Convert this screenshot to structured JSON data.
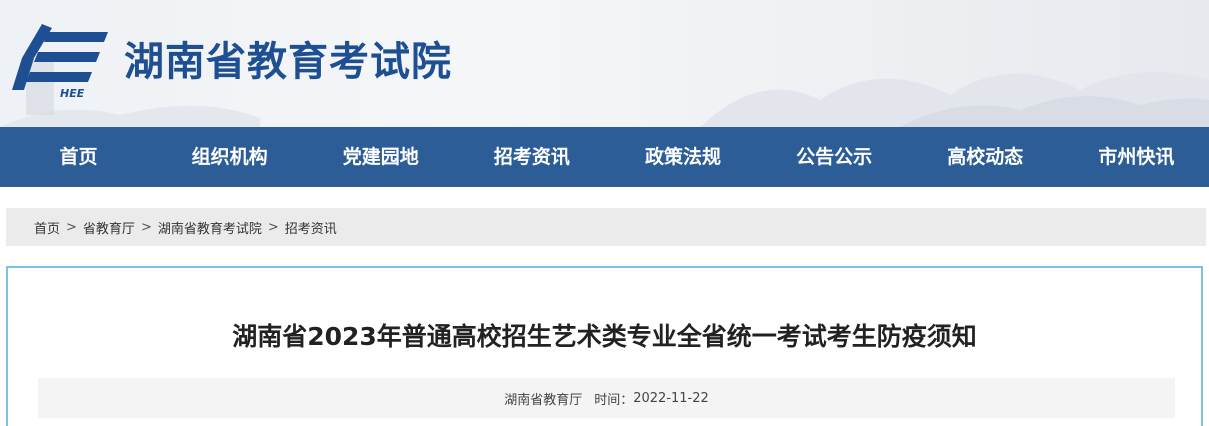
{
  "header": {
    "logo_text": "HEE",
    "site_title": "湖南省教育考试院"
  },
  "nav": {
    "items": [
      {
        "label": "首页"
      },
      {
        "label": "组织机构"
      },
      {
        "label": "党建园地"
      },
      {
        "label": "招考资讯"
      },
      {
        "label": "政策法规"
      },
      {
        "label": "公告公示"
      },
      {
        "label": "高校动态"
      },
      {
        "label": "市州快讯"
      }
    ]
  },
  "breadcrumb": {
    "items": [
      "首页",
      "省教育厅",
      "湖南省教育考试院",
      "招考资讯"
    ],
    "separator": ">"
  },
  "article": {
    "title": "湖南省2023年普通高校招生艺术类专业全省统一考试考生防疫须知",
    "source": "湖南省教育厅",
    "time_label": "时间：",
    "time_value": "2022-11-22"
  },
  "colors": {
    "nav_bg": "#2c5d96",
    "title_blue": "#1e4f93",
    "article_border": "#7ec3de"
  }
}
